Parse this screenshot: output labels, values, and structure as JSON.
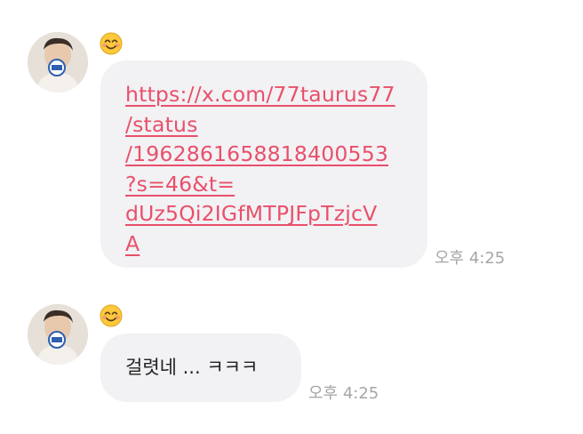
{
  "messages": [
    {
      "emoji": "😊",
      "text": "https://x.com/77taurus77\n/status\n/1962861658818400553\n?s=46&t=\ndUz5Qi2IGfMTPJFpTzjcV\nA",
      "time": "오후 4:25",
      "is_link": true
    },
    {
      "emoji": "😊",
      "text": "걸렷네 ... ㅋㅋㅋ",
      "time": "오후 4:25",
      "is_link": false
    }
  ],
  "colors": {
    "link": "#e8506a",
    "bubble": "#f2f1f4",
    "timestamp": "#a6a6a6"
  }
}
